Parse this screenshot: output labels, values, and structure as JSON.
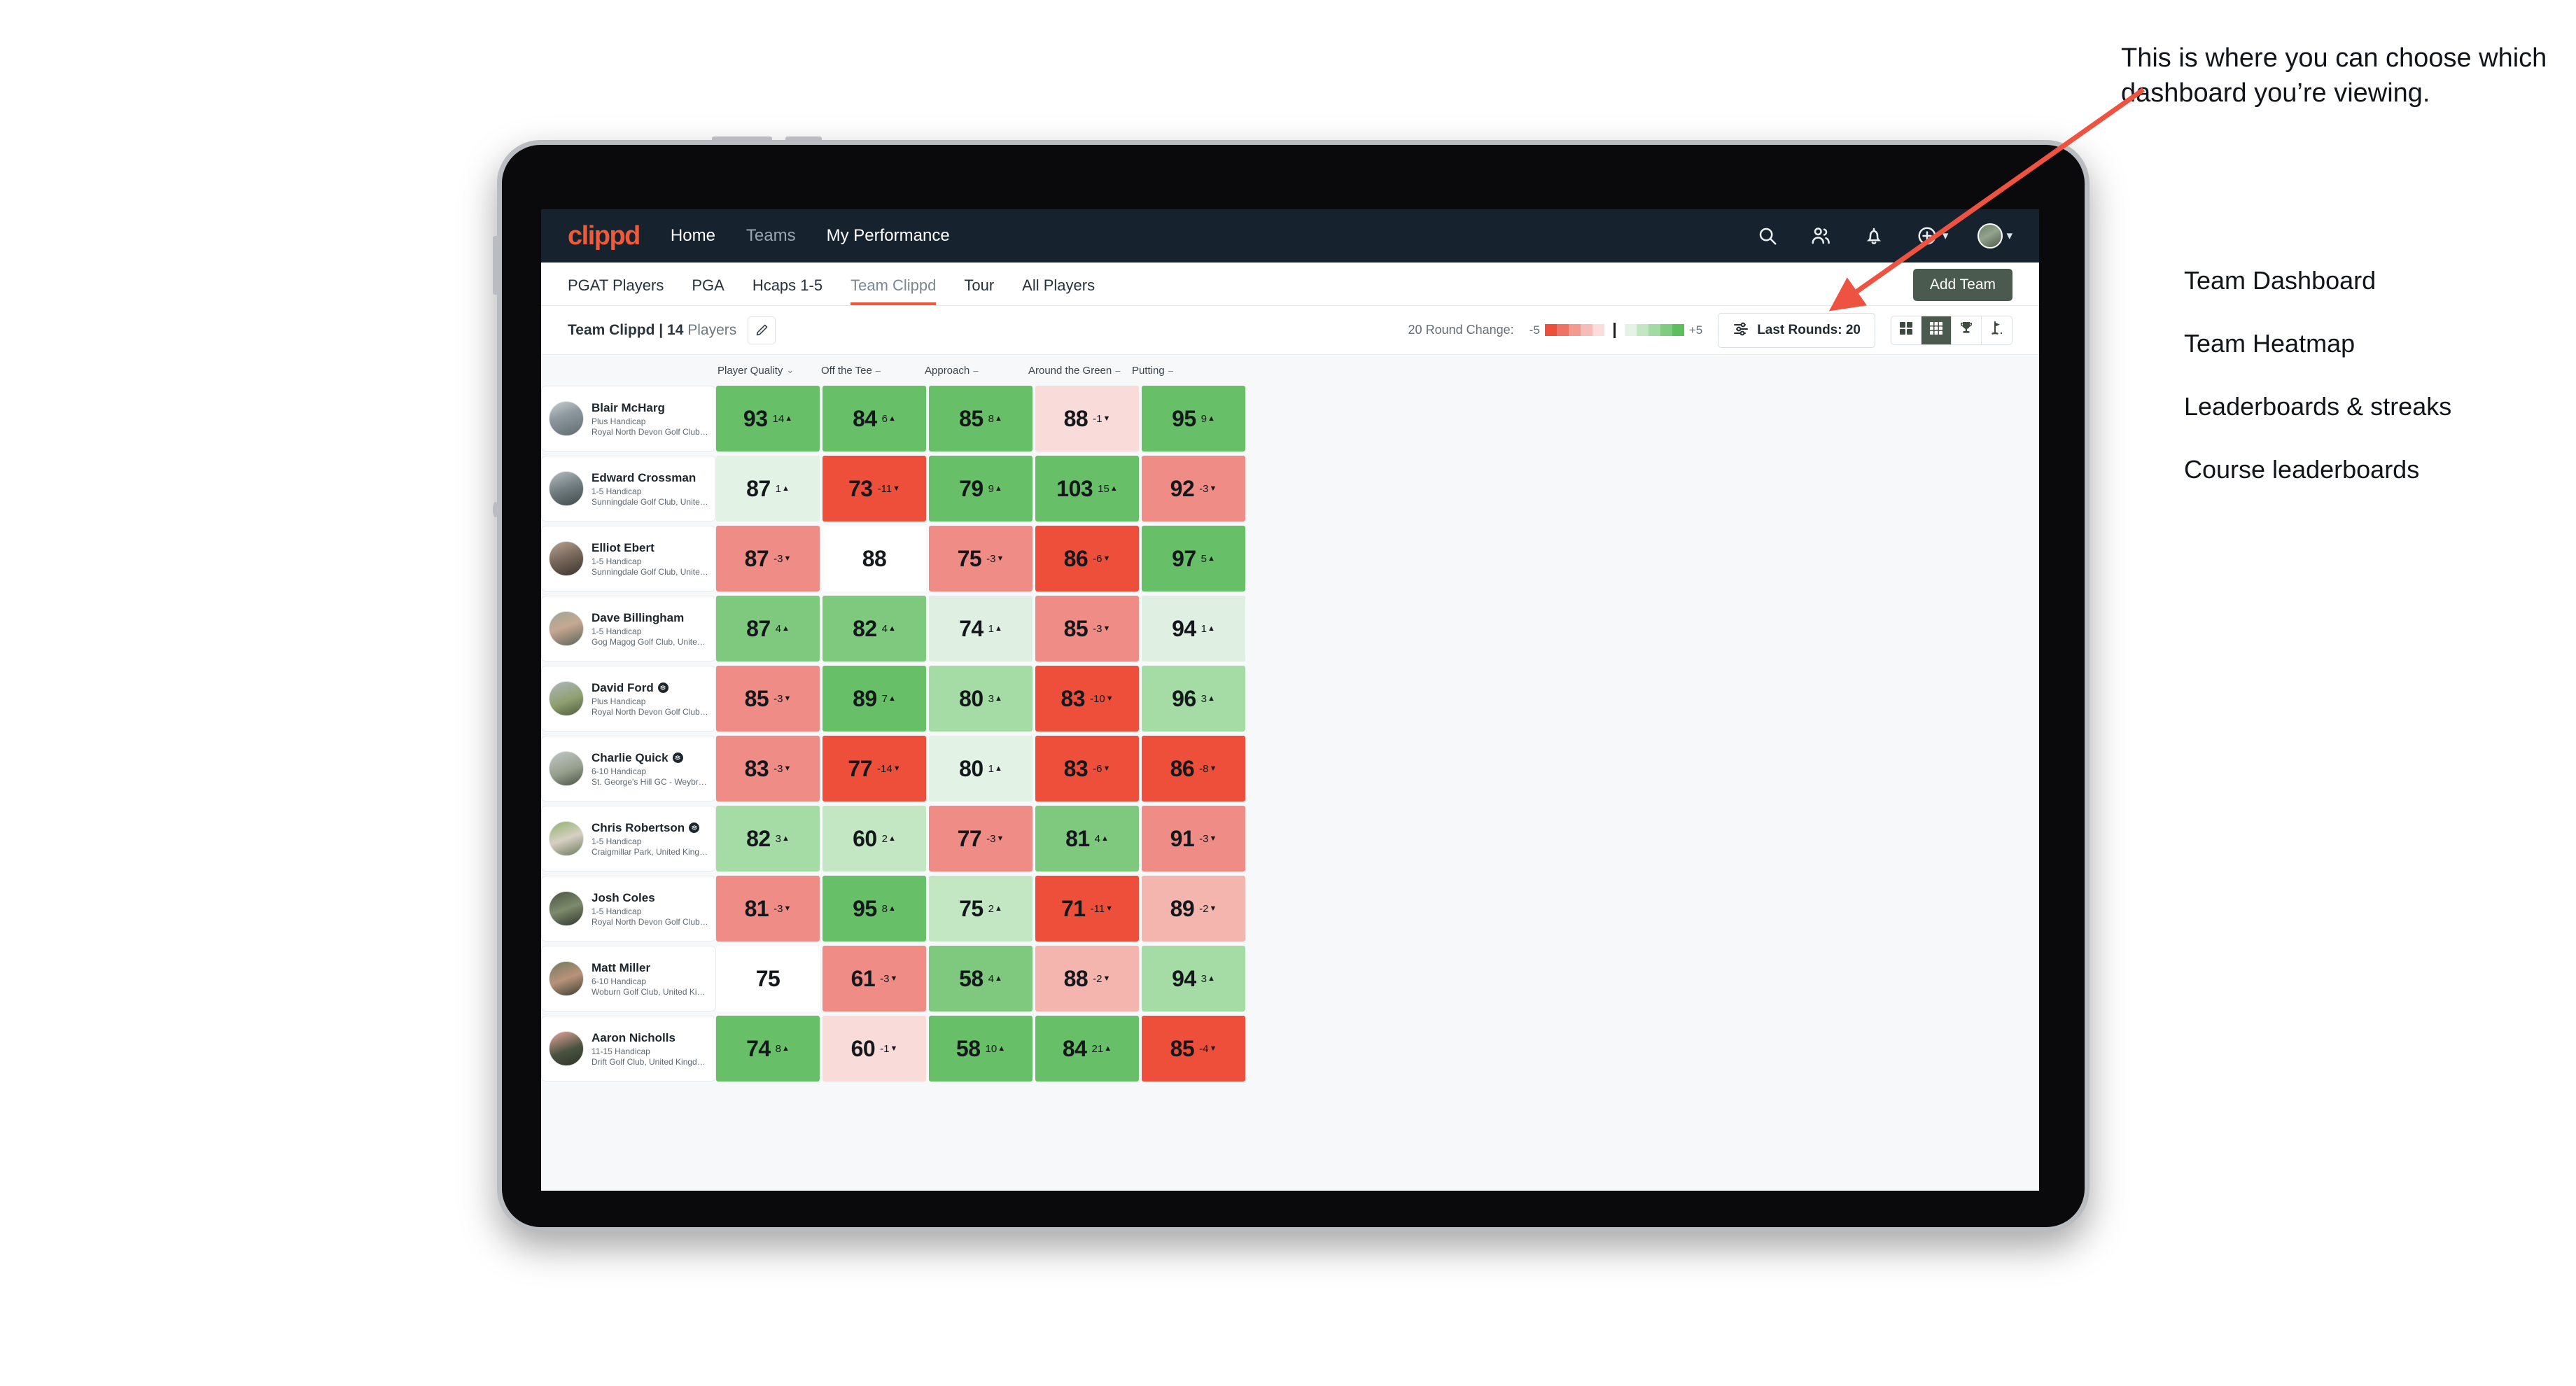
{
  "brand": "clippd",
  "nav": {
    "links": [
      {
        "label": "Home",
        "active": true
      },
      {
        "label": "Teams",
        "active": false
      },
      {
        "label": "My Performance",
        "active": true
      }
    ],
    "icons": [
      "search-icon",
      "people-icon",
      "bell-icon",
      "plus-circle-icon",
      "avatar"
    ]
  },
  "tabs": [
    {
      "label": "PGAT Players",
      "active": false
    },
    {
      "label": "PGA",
      "active": false
    },
    {
      "label": "Hcaps 1-5",
      "active": false
    },
    {
      "label": "Team Clippd",
      "active": true
    },
    {
      "label": "Tour",
      "active": false
    },
    {
      "label": "All Players",
      "active": false
    }
  ],
  "add_team_label": "Add Team",
  "toolbar": {
    "team_name": "Team Clippd",
    "separator": "|",
    "player_count": "14",
    "players_word": "Players",
    "edit_icon": "pencil-icon",
    "round_change_label": "20 Round Change:",
    "scale_min": "-5",
    "scale_max": "+5",
    "rounds_button_label": "Last Rounds: 20",
    "rounds_button_icon": "filter-sliders-icon",
    "views": [
      {
        "name": "team-dashboard",
        "icon": "grid-4-icon",
        "active": false
      },
      {
        "name": "team-heatmap",
        "icon": "grid-9-icon",
        "active": true
      },
      {
        "name": "leaderboards-streaks",
        "icon": "trophy-icon",
        "active": false
      },
      {
        "name": "course-leaderboards",
        "icon": "golf-flag-icon",
        "active": false
      }
    ]
  },
  "columns": [
    {
      "label": "Player Quality",
      "marker": "⌄"
    },
    {
      "label": "Off the Tee",
      "marker": "–"
    },
    {
      "label": "Approach",
      "marker": "–"
    },
    {
      "label": "Around the Green",
      "marker": "–"
    },
    {
      "label": "Putting",
      "marker": "–"
    }
  ],
  "chart_data": {
    "type": "heatmap",
    "title": "Team Clippd — Team Heatmap",
    "categories": [
      "Player Quality",
      "Off the Tee",
      "Approach",
      "Around the Green",
      "Putting"
    ],
    "legend": {
      "label": "20 Round Change:",
      "min": -5,
      "max": 5,
      "position": "top-right"
    },
    "rows": [
      {
        "player": "Blair McHarg",
        "handicap": "Plus Handicap",
        "club": "Royal North Devon Golf Club, United Kingdom",
        "verified": false,
        "avatar": "linear-gradient(160deg,#c9cfd2 0%,#8e9aa0 40%,#5f6b6e 100%)",
        "cells": [
          {
            "value": "93",
            "delta": "14",
            "dir": "up",
            "color": "#67c067"
          },
          {
            "value": "84",
            "delta": "6",
            "dir": "up",
            "color": "#67c067"
          },
          {
            "value": "85",
            "delta": "8",
            "dir": "up",
            "color": "#67c067"
          },
          {
            "value": "88",
            "delta": "-1",
            "dir": "down",
            "color": "#f9dcd9"
          },
          {
            "value": "95",
            "delta": "9",
            "dir": "up",
            "color": "#67c067"
          }
        ]
      },
      {
        "player": "Edward Crossman",
        "handicap": "1-5 Handicap",
        "club": "Sunningdale Golf Club, United Kingdom",
        "verified": false,
        "avatar": "linear-gradient(160deg,#b6bec0 0%,#6f7b7e 50%,#3f4a4c 100%)",
        "cells": [
          {
            "value": "87",
            "delta": "1",
            "dir": "up",
            "color": "#e2f2e5"
          },
          {
            "value": "73",
            "delta": "-11",
            "dir": "down",
            "color": "#ee4f3b"
          },
          {
            "value": "79",
            "delta": "9",
            "dir": "up",
            "color": "#67c067"
          },
          {
            "value": "103",
            "delta": "15",
            "dir": "up",
            "color": "#67c067"
          },
          {
            "value": "92",
            "delta": "-3",
            "dir": "down",
            "color": "#ef8c85"
          }
        ]
      },
      {
        "player": "Elliot Ebert",
        "handicap": "1-5 Handicap",
        "club": "Sunningdale Golf Club, United Kingdom",
        "verified": false,
        "avatar": "linear-gradient(160deg,#b9a393 0%,#7b6a5d 45%,#3b342f 100%)",
        "cells": [
          {
            "value": "87",
            "delta": "-3",
            "dir": "down",
            "color": "#ef8c85"
          },
          {
            "value": "88",
            "delta": "",
            "dir": "",
            "color": "#ffffff"
          },
          {
            "value": "75",
            "delta": "-3",
            "dir": "down",
            "color": "#ef8c85"
          },
          {
            "value": "86",
            "delta": "-6",
            "dir": "down",
            "color": "#ee4f3b"
          },
          {
            "value": "97",
            "delta": "5",
            "dir": "up",
            "color": "#67c067"
          }
        ]
      },
      {
        "player": "Dave Billingham",
        "handicap": "1-5 Handicap",
        "club": "Gog Magog Golf Club, United Kingdom",
        "verified": false,
        "avatar": "linear-gradient(160deg,#9aa694 0%,#c7a892 45%,#5a6358 100%)",
        "cells": [
          {
            "value": "87",
            "delta": "4",
            "dir": "up",
            "color": "#7ec97e"
          },
          {
            "value": "82",
            "delta": "4",
            "dir": "up",
            "color": "#7ec97e"
          },
          {
            "value": "74",
            "delta": "1",
            "dir": "up",
            "color": "#dff0e2"
          },
          {
            "value": "85",
            "delta": "-3",
            "dir": "down",
            "color": "#ef8c85"
          },
          {
            "value": "94",
            "delta": "1",
            "dir": "up",
            "color": "#dff0e2"
          }
        ]
      },
      {
        "player": "David Ford",
        "handicap": "Plus Handicap",
        "club": "Royal North Devon Golf Club, United Kingdom",
        "verified": true,
        "avatar": "linear-gradient(160deg,#aeb7bb 0%,#8fa06f 55%,#4e5a3f 100%)",
        "cells": [
          {
            "value": "85",
            "delta": "-3",
            "dir": "down",
            "color": "#ef8c85"
          },
          {
            "value": "89",
            "delta": "7",
            "dir": "up",
            "color": "#67c067"
          },
          {
            "value": "80",
            "delta": "3",
            "dir": "up",
            "color": "#a5dba5"
          },
          {
            "value": "83",
            "delta": "-10",
            "dir": "down",
            "color": "#ee4f3b"
          },
          {
            "value": "96",
            "delta": "3",
            "dir": "up",
            "color": "#a5dba5"
          }
        ]
      },
      {
        "player": "Charlie Quick",
        "handicap": "6-10 Handicap",
        "club": "St. George's Hill GC - Weybridge - Surrey, Uni...",
        "verified": true,
        "avatar": "linear-gradient(160deg,#c2c8cb 0%,#97a08c 55%,#4b5346 100%)",
        "cells": [
          {
            "value": "83",
            "delta": "-3",
            "dir": "down",
            "color": "#ef8c85"
          },
          {
            "value": "77",
            "delta": "-14",
            "dir": "down",
            "color": "#ee4f3b"
          },
          {
            "value": "80",
            "delta": "1",
            "dir": "up",
            "color": "#e2f2e5"
          },
          {
            "value": "83",
            "delta": "-6",
            "dir": "down",
            "color": "#ee4f3b"
          },
          {
            "value": "86",
            "delta": "-8",
            "dir": "down",
            "color": "#ee4f3b"
          }
        ]
      },
      {
        "player": "Chris Robertson",
        "handicap": "1-5 Handicap",
        "club": "Craigmillar Park, United Kingdom",
        "verified": true,
        "avatar": "linear-gradient(160deg,#8db36a 0%,#d8cfc4 50%,#6c7a5c 100%)",
        "cells": [
          {
            "value": "82",
            "delta": "3",
            "dir": "up",
            "color": "#a5dba5"
          },
          {
            "value": "60",
            "delta": "2",
            "dir": "up",
            "color": "#c3e7c3"
          },
          {
            "value": "77",
            "delta": "-3",
            "dir": "down",
            "color": "#ef8c85"
          },
          {
            "value": "81",
            "delta": "4",
            "dir": "up",
            "color": "#7ec97e"
          },
          {
            "value": "91",
            "delta": "-3",
            "dir": "down",
            "color": "#ef8c85"
          }
        ]
      },
      {
        "player": "Josh Coles",
        "handicap": "1-5 Handicap",
        "club": "Royal North Devon Golf Club, United Kingdom",
        "verified": false,
        "avatar": "linear-gradient(160deg,#4c5543 0%,#7d8a6b 50%,#2f352a 100%)",
        "cells": [
          {
            "value": "81",
            "delta": "-3",
            "dir": "down",
            "color": "#ef8c85"
          },
          {
            "value": "95",
            "delta": "8",
            "dir": "up",
            "color": "#67c067"
          },
          {
            "value": "75",
            "delta": "2",
            "dir": "up",
            "color": "#c3e7c3"
          },
          {
            "value": "71",
            "delta": "-11",
            "dir": "down",
            "color": "#ee4f3b"
          },
          {
            "value": "89",
            "delta": "-2",
            "dir": "down",
            "color": "#f4b5af"
          }
        ]
      },
      {
        "player": "Matt Miller",
        "handicap": "6-10 Handicap",
        "club": "Woburn Golf Club, United Kingdom",
        "verified": false,
        "avatar": "linear-gradient(160deg,#6f7a5e 0%,#b9927a 50%,#39402f 100%)",
        "cells": [
          {
            "value": "75",
            "delta": "",
            "dir": "",
            "color": "#ffffff"
          },
          {
            "value": "61",
            "delta": "-3",
            "dir": "down",
            "color": "#ef8c85"
          },
          {
            "value": "58",
            "delta": "4",
            "dir": "up",
            "color": "#7ec97e"
          },
          {
            "value": "88",
            "delta": "-2",
            "dir": "down",
            "color": "#f4b5af"
          },
          {
            "value": "94",
            "delta": "3",
            "dir": "up",
            "color": "#a5dba5"
          }
        ]
      },
      {
        "player": "Aaron Nicholls",
        "handicap": "11-15 Handicap",
        "club": "Drift Golf Club, United Kingdom",
        "verified": false,
        "avatar": "linear-gradient(160deg,#e8a79c 0%,#4a5340 55%,#2e3328 100%)",
        "cells": [
          {
            "value": "74",
            "delta": "8",
            "dir": "up",
            "color": "#67c067"
          },
          {
            "value": "60",
            "delta": "-1",
            "dir": "down",
            "color": "#f9dcd9"
          },
          {
            "value": "58",
            "delta": "10",
            "dir": "up",
            "color": "#67c067"
          },
          {
            "value": "84",
            "delta": "21",
            "dir": "up",
            "color": "#67c067"
          },
          {
            "value": "85",
            "delta": "-4",
            "dir": "down",
            "color": "#ee4f3b"
          }
        ]
      }
    ]
  },
  "annotation": {
    "paragraph": "This is where you can choose which dashboard you’re viewing.",
    "items": [
      "Team Dashboard",
      "Team Heatmap",
      "Leaderboards & streaks",
      "Course leaderboards"
    ],
    "arrow_color": "#ed5340"
  },
  "scale_colors": [
    "#ee4f3b",
    "#f07264",
    "#f29a90",
    "#f6bdb6",
    "#fbdedb",
    "#e4f3e6",
    "#c3e7c3",
    "#a2dba2",
    "#7ecd7e",
    "#5cbf5c"
  ]
}
